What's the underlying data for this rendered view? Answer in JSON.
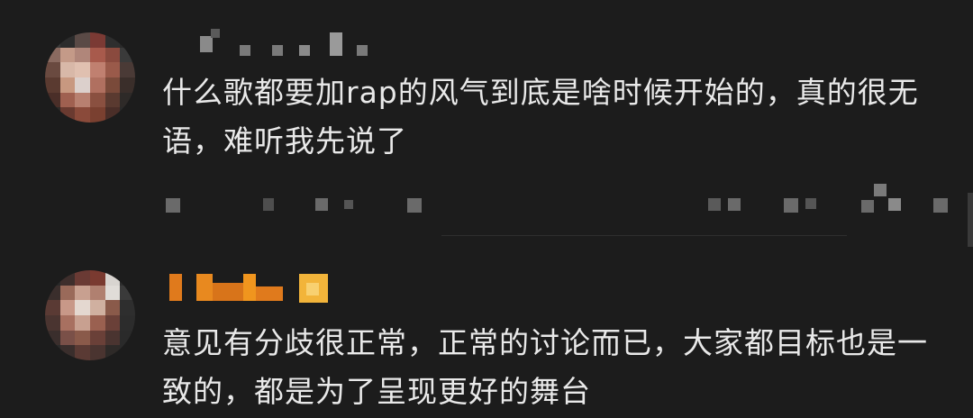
{
  "comments": [
    {
      "author": "",
      "text": "什么歌都要加rap的风气到底是啥时候开始的，真的很无语，难听我先说了",
      "avatar_colors": [
        "#3b3b3b",
        "#2c2c2c",
        "#5a4a46",
        "#7b3a34",
        "#2e2e2e",
        "#2a2a2a",
        "#8a6a60",
        "#c49a88",
        "#b0867a",
        "#a85a4c",
        "#8a4a3e",
        "#3a3a3a",
        "#6a4a40",
        "#d8b8a8",
        "#e0c0b0",
        "#c08070",
        "#9a5a4a",
        "#4a3a36",
        "#5a3a30",
        "#c89880",
        "#dcd0cc",
        "#b07060",
        "#7a4a3a",
        "#3a2e2a",
        "#4a2e28",
        "#a06050",
        "#b88070",
        "#8a5040",
        "#5a3a30",
        "#2e2a28",
        "#2e2a28",
        "#6a3a30",
        "#8a4a3a",
        "#7a4030",
        "#4a2e28",
        "#2a2a2a"
      ]
    },
    {
      "author": "",
      "text": "意见有分歧很正常，正常的讨论而已，大家都目标也是一致的，都是为了呈现更好的舞台",
      "avatar_colors": [
        "#2a2a2a",
        "#3e2e2c",
        "#6a3a34",
        "#7a3a30",
        "#d8d4d0",
        "#2e2e2e",
        "#3a2e2c",
        "#9a6a5a",
        "#c8a090",
        "#b08070",
        "#e0dcd8",
        "#3a3a3a",
        "#5a3a34",
        "#c89888",
        "#e4d8d0",
        "#d0b0a0",
        "#8a5a4a",
        "#2e2e2e",
        "#4a3430",
        "#a87060",
        "#c8a090",
        "#9a6050",
        "#6a4038",
        "#2c2c2c",
        "#3a2e2c",
        "#7a5048",
        "#8a5a4a",
        "#6a4038",
        "#4a3430",
        "#2a2a2a",
        "#2a2a2a",
        "#3a2e2c",
        "#5a3a34",
        "#4a3430",
        "#2e2a28",
        "#2a2a2a"
      ]
    }
  ]
}
